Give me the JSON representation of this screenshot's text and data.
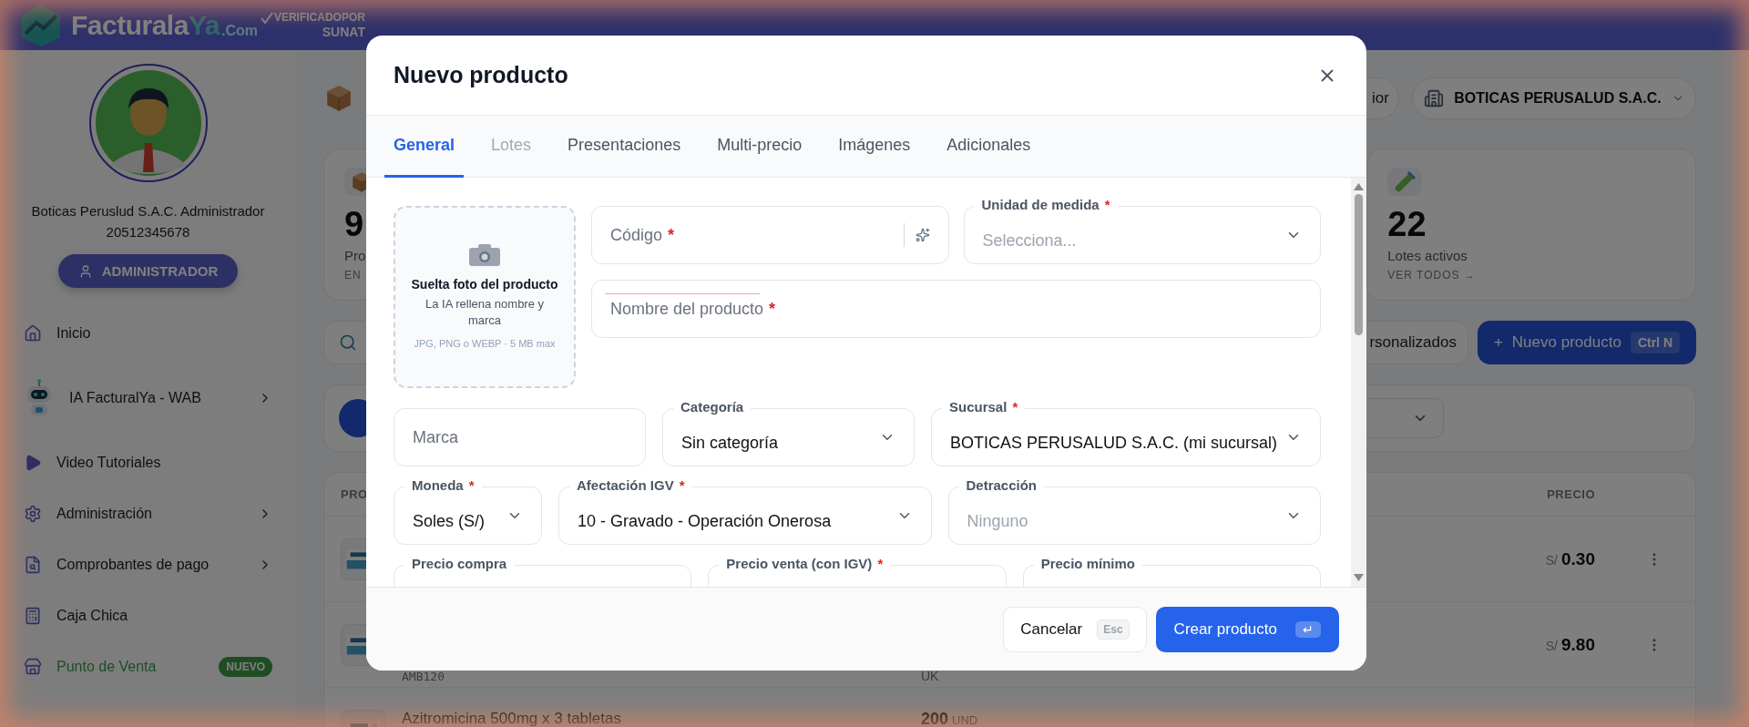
{
  "header": {
    "logo": {
      "name": "Facturala",
      "accent": "Ya",
      "suffix": ".Com"
    },
    "verified": {
      "label": "VERIFICADO",
      "by": "POR",
      "authority": "SUNAT"
    }
  },
  "sidebar": {
    "user_name": "Boticas Peruslud S.A.C. Administrador",
    "ruc": "20512345678",
    "role_button": "ADMINISTRADOR",
    "items": [
      {
        "label": "Inicio",
        "submenu": false,
        "highlighted": false
      },
      {
        "label": "IA FacturalYa - WAB",
        "submenu": true,
        "highlighted": false
      },
      {
        "label": "Video Tutoriales",
        "submenu": false,
        "highlighted": false
      },
      {
        "label": "Administración",
        "submenu": true,
        "highlighted": false
      },
      {
        "label": "Comprobantes de pago",
        "submenu": true,
        "highlighted": false
      },
      {
        "label": "Caja Chica",
        "submenu": false,
        "highlighted": false
      },
      {
        "label": "Punto de Venta",
        "submenu": false,
        "highlighted": true,
        "badge": "NUEVO"
      }
    ]
  },
  "main": {
    "top_bar": {
      "partial_button": "ior",
      "company": "BOTICAS PERUSALUD S.A.C."
    },
    "stats": [
      {
        "value": "9",
        "label": "Pro",
        "link": "EN"
      },
      {
        "value": "22",
        "label": "Lotes activos",
        "link": "VER TODOS →"
      }
    ],
    "toolbar": {
      "custom_button": "rsonalizados",
      "new_button": {
        "plus": "+",
        "label": "Nuevo producto",
        "shortcut": "Ctrl N"
      }
    },
    "table": {
      "columns": [
        {
          "label": "PRO"
        },
        {
          "label": "PRECIO"
        }
      ],
      "rows": [
        {
          "currency": "S/",
          "price": "0.30"
        },
        {
          "sku": "AMB120",
          "stock_sub": "UK",
          "currency": "S/",
          "price": "9.80"
        },
        {
          "name": "Azitromicina 500mg x 3 tabletas",
          "stock": "200",
          "stock_unit": "UND"
        }
      ]
    }
  },
  "modal": {
    "title": "Nuevo producto",
    "tabs": [
      {
        "label": "General",
        "selected": true,
        "disabled": false
      },
      {
        "label": "Lotes",
        "selected": false,
        "disabled": true
      },
      {
        "label": "Presentaciones",
        "selected": false,
        "disabled": false
      },
      {
        "label": "Multi-precio",
        "selected": false,
        "disabled": false
      },
      {
        "label": "Imágenes",
        "selected": false,
        "disabled": false
      },
      {
        "label": "Adicionales",
        "selected": false,
        "disabled": false
      }
    ],
    "photo_drop": {
      "title": "Suelta foto del producto",
      "subtitle": "La IA rellena nombre y marca",
      "formats": "JPG, PNG o WEBP · 5 MB max"
    },
    "top_fields": [
      {
        "kind": "text",
        "label": "Código",
        "required_mark": "*",
        "ai_button": true
      },
      {
        "kind": "select",
        "label": "Unidad de medida",
        "required_mark": "*",
        "placeholder": "Selecciona..."
      },
      {
        "kind": "text",
        "label": "Nombre del producto",
        "required_mark": "*",
        "highlighted": true
      }
    ],
    "field_rows": [
      [
        {
          "kind": "text",
          "label": "Marca"
        },
        {
          "kind": "select",
          "label": "Categoría",
          "value": "Sin categoría"
        },
        {
          "kind": "select",
          "label": "Sucursal",
          "required_mark": "*",
          "value": "BOTICAS PERUSALUD S.A.C. (mi sucursal)"
        }
      ],
      [
        {
          "kind": "select",
          "label": "Moneda",
          "required_mark": "*",
          "value": "Soles (S/)"
        },
        {
          "kind": "select",
          "label": "Afectación IGV",
          "required_mark": "*",
          "value": "10 - Gravado - Operación Onerosa"
        },
        {
          "kind": "select",
          "label": "Detracción",
          "placeholder": "Ninguno"
        }
      ],
      [
        {
          "kind": "price",
          "label": "Precio compra"
        },
        {
          "kind": "price",
          "label": "Precio venta (con IGV)",
          "required_mark": "*"
        },
        {
          "kind": "price",
          "label": "Precio mínimo"
        }
      ]
    ],
    "footer": {
      "cancel": {
        "label": "Cancelar",
        "shortcut": "Esc"
      },
      "submit": {
        "label": "Crear producto",
        "shortcut": "↵"
      }
    }
  }
}
